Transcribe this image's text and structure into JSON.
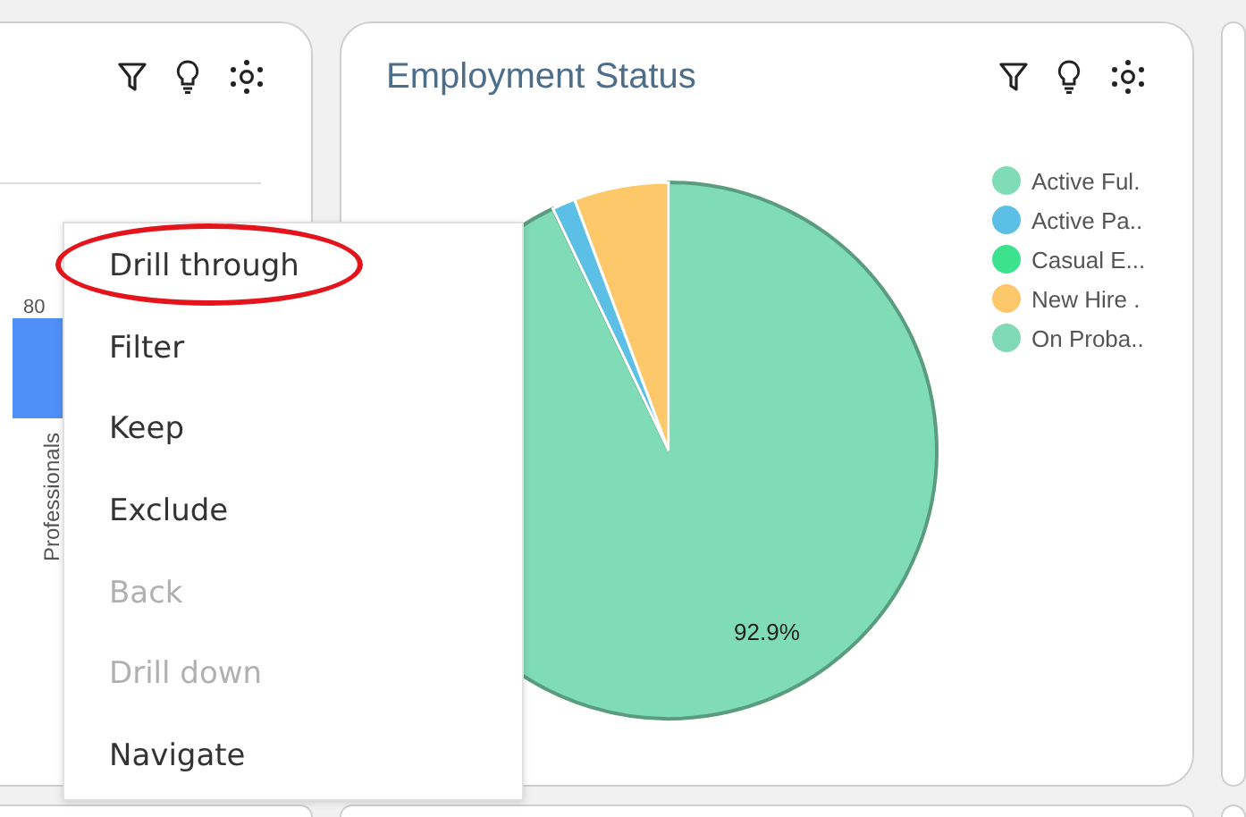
{
  "left_card": {
    "tick_label": "80",
    "category_label": "Professionals"
  },
  "employment_card": {
    "title": "Employment Status",
    "legend": [
      {
        "label": "Active Ful.",
        "color": "#7fdcb6"
      },
      {
        "label": "Active Pa..",
        "color": "#5cbfe6"
      },
      {
        "label": "Casual E...",
        "color": "#3de28f"
      },
      {
        "label": "New Hire .",
        "color": "#fcc86a"
      },
      {
        "label": "On Proba..",
        "color": "#80dab7"
      }
    ],
    "chart_data": {
      "type": "pie",
      "values": [
        92.9,
        1.4,
        0,
        5.7,
        0
      ],
      "value_labels": [
        "92.9%",
        null,
        null,
        null,
        null
      ]
    }
  },
  "context_menu": {
    "items": [
      {
        "label": "Drill through",
        "disabled": false,
        "circled": true
      },
      {
        "label": "Filter",
        "disabled": false,
        "circled": false
      },
      {
        "label": "Keep",
        "disabled": false,
        "circled": false
      },
      {
        "label": "Exclude",
        "disabled": false,
        "circled": false
      },
      {
        "label": "Back",
        "disabled": true,
        "circled": false
      },
      {
        "label": "Drill down",
        "disabled": true,
        "circled": false
      },
      {
        "label": "Navigate",
        "disabled": false,
        "circled": false
      }
    ]
  }
}
